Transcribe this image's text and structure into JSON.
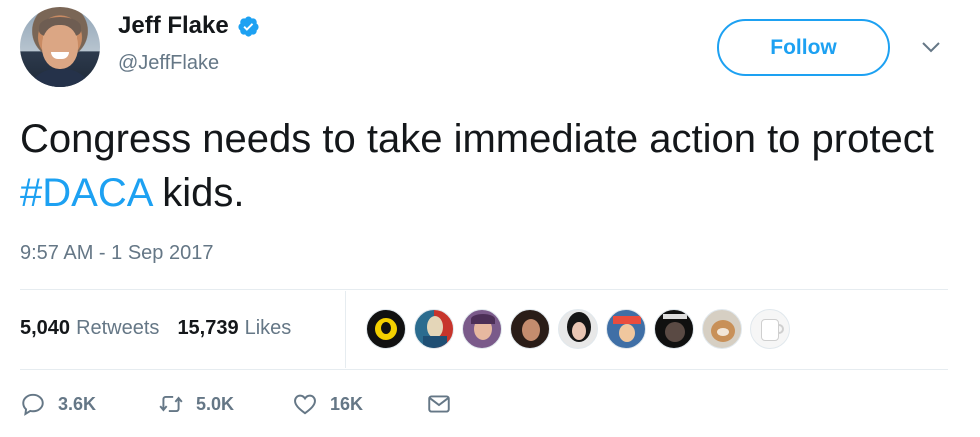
{
  "author": {
    "name": "Jeff Flake",
    "handle": "@JeffFlake",
    "verified": true
  },
  "follow_button": {
    "label": "Follow"
  },
  "tweet": {
    "text_before": "Congress needs to take immediate action to protect ",
    "hashtag": "#DACA",
    "text_after": " kids.",
    "timestamp": "9:57 AM - 1 Sep 2017"
  },
  "stats": {
    "retweets_count": "5,040",
    "retweets_label": "Retweets",
    "likes_count": "15,739",
    "likes_label": "Likes"
  },
  "liked_by_avatars": [
    "avatar-1",
    "avatar-2",
    "avatar-3",
    "avatar-4",
    "avatar-5",
    "avatar-6",
    "avatar-7",
    "avatar-8",
    "avatar-9"
  ],
  "actions": {
    "reply_count": "3.6K",
    "retweet_count": "5.0K",
    "like_count": "16K"
  },
  "colors": {
    "accent": "#1da1f2",
    "text": "#14171a",
    "secondary_text": "#657786",
    "divider": "#e6ecf0"
  },
  "icons": {
    "verified": "verified-badge-icon",
    "caret": "chevron-down-icon",
    "reply": "reply-icon",
    "retweet": "retweet-icon",
    "like": "heart-icon",
    "dm": "envelope-icon"
  }
}
